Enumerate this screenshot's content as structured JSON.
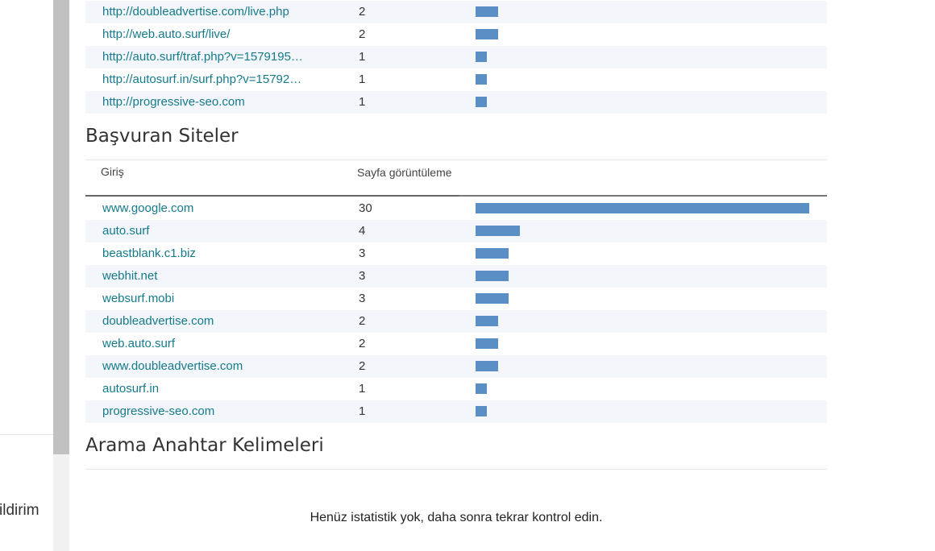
{
  "left_panel": {
    "notification_label_fragment": "ildirim"
  },
  "top_table": {
    "rows": [
      {
        "url": "http://doubleadvertise.com/live.php",
        "count": "2",
        "value": 2
      },
      {
        "url": "http://web.auto.surf/live/",
        "count": "2",
        "value": 2
      },
      {
        "url": "http://auto.surf/traf.php?v=1579195…",
        "count": "1",
        "value": 1
      },
      {
        "url": "http://autosurf.in/surf.php?v=15792…",
        "count": "1",
        "value": 1
      },
      {
        "url": "http://progressive-seo.com",
        "count": "1",
        "value": 1
      }
    ]
  },
  "referrers": {
    "title": "Başvuran Siteler",
    "col_entry": "Giriş",
    "col_views": "Sayfa görüntüleme",
    "max_value": 30,
    "rows": [
      {
        "site": "www.google.com",
        "count": "30",
        "value": 30
      },
      {
        "site": "auto.surf",
        "count": "4",
        "value": 4
      },
      {
        "site": "beastblank.c1.biz",
        "count": "3",
        "value": 3
      },
      {
        "site": "webhit.net",
        "count": "3",
        "value": 3
      },
      {
        "site": "websurf.mobi",
        "count": "3",
        "value": 3
      },
      {
        "site": "doubleadvertise.com",
        "count": "2",
        "value": 2
      },
      {
        "site": "web.auto.surf",
        "count": "2",
        "value": 2
      },
      {
        "site": "www.doubleadvertise.com",
        "count": "2",
        "value": 2
      },
      {
        "site": "autosurf.in",
        "count": "1",
        "value": 1
      },
      {
        "site": "progressive-seo.com",
        "count": "1",
        "value": 1
      }
    ]
  },
  "keywords": {
    "title": "Arama Anahtar Kelimeleri",
    "empty_message": "Henüz istatistik yok, daha sonra tekrar kontrol edin."
  },
  "colors": {
    "link": "#157a8c",
    "bar": "#5b8ec4",
    "row_alt": "#f3f6fa"
  }
}
